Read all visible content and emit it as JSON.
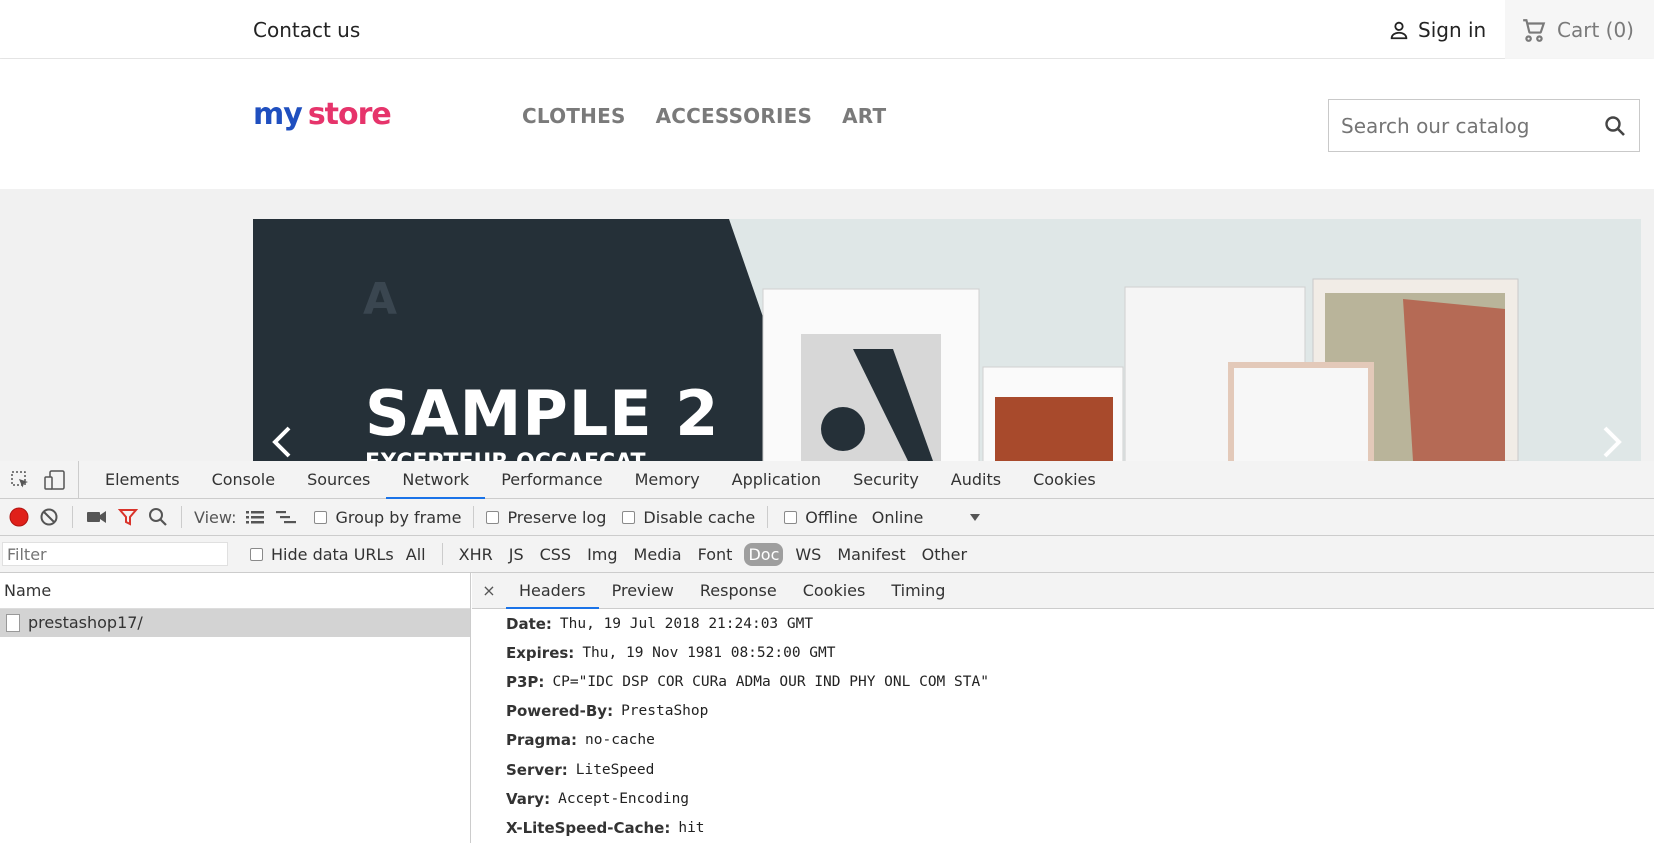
{
  "store": {
    "contact": "Contact us",
    "signin": "Sign in",
    "cart": "Cart (0)",
    "logo": {
      "text_my": "my",
      "text_store": "store"
    },
    "nav": [
      "CLOTHES",
      "ACCESSORIES",
      "ART"
    ],
    "search_placeholder": "Search our catalog",
    "slide": {
      "title": "SAMPLE 2",
      "subtitle": "EXCEPTEUR OCCAECAT"
    }
  },
  "devtools": {
    "tabs": [
      "Elements",
      "Console",
      "Sources",
      "Network",
      "Performance",
      "Memory",
      "Application",
      "Security",
      "Audits",
      "Cookies"
    ],
    "active_tab": "Network",
    "toolbar": {
      "view_label": "View:",
      "group_by_frame": "Group by frame",
      "preserve_log": "Preserve log",
      "disable_cache": "Disable cache",
      "offline": "Offline",
      "throttle": "Online"
    },
    "filter": {
      "placeholder": "Filter",
      "hide_data_urls": "Hide data URLs",
      "types": [
        "All",
        "XHR",
        "JS",
        "CSS",
        "Img",
        "Media",
        "Font",
        "Doc",
        "WS",
        "Manifest",
        "Other"
      ],
      "active_type": "Doc"
    },
    "name_header": "Name",
    "requests": [
      "prestashop17/"
    ],
    "detail_tabs": [
      "Headers",
      "Preview",
      "Response",
      "Cookies",
      "Timing"
    ],
    "active_detail_tab": "Headers",
    "close": "×",
    "headers": [
      {
        "key": "Date:",
        "value": "Thu, 19 Jul 2018 21:24:03 GMT"
      },
      {
        "key": "Expires:",
        "value": "Thu, 19 Nov 1981 08:52:00 GMT"
      },
      {
        "key": "P3P:",
        "value": "CP=\"IDC DSP COR CURa ADMa OUR IND PHY ONL COM STA\""
      },
      {
        "key": "Powered-By:",
        "value": "PrestaShop"
      },
      {
        "key": "Pragma:",
        "value": "no-cache"
      },
      {
        "key": "Server:",
        "value": "LiteSpeed"
      },
      {
        "key": "Vary:",
        "value": "Accept-Encoding"
      },
      {
        "key": "X-LiteSpeed-Cache:",
        "value": "hit"
      }
    ],
    "colors": {
      "record": "#e0201a",
      "filter_icon": "#d9342b",
      "active_tab_underline": "#1a73e8"
    }
  }
}
